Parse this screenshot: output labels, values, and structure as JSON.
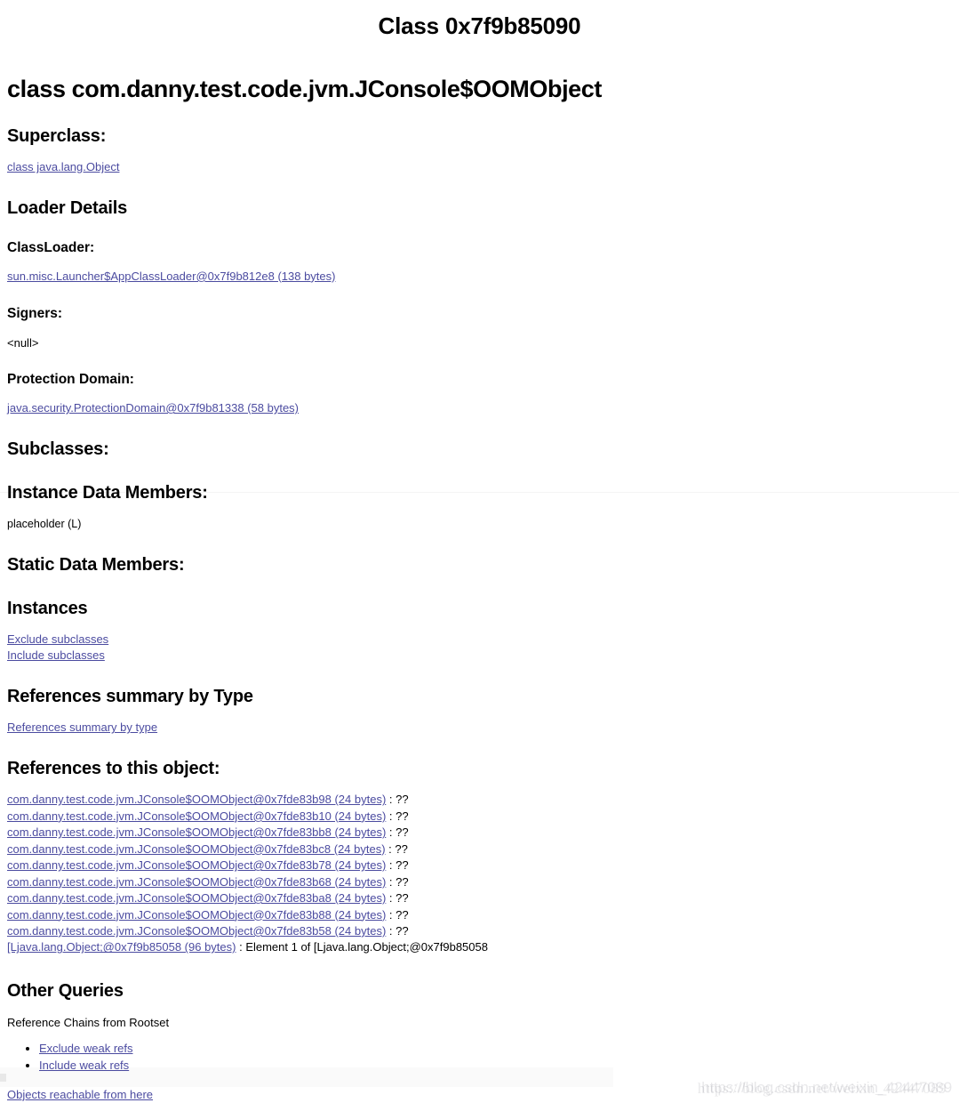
{
  "document": {
    "title": "Class 0x7f9b85090",
    "class_header": "class com.danny.test.code.jvm.JConsole$OOMObject"
  },
  "superclass": {
    "heading": "Superclass:",
    "link": "class java.lang.Object"
  },
  "loader_details": {
    "heading": "Loader Details",
    "classloader_label": "ClassLoader:",
    "classloader_link": "sun.misc.Launcher$AppClassLoader@0x7f9b812e8 (138 bytes)",
    "signers_label": "Signers:",
    "signers_value": "<null>",
    "protection_domain_label": "Protection Domain:",
    "protection_domain_link": "java.security.ProtectionDomain@0x7f9b81338 (58 bytes)"
  },
  "subclasses": {
    "heading": "Subclasses:"
  },
  "instance_data_members": {
    "heading": "Instance Data Members:",
    "members": [
      "placeholder (L)"
    ]
  },
  "static_data_members": {
    "heading": "Static Data Members:"
  },
  "instances": {
    "heading": "Instances",
    "links": [
      "Exclude subclasses",
      "Include subclasses"
    ]
  },
  "references_summary": {
    "heading": "References summary by Type",
    "link": "References summary by type"
  },
  "references_to_object": {
    "heading": "References to this object:",
    "rows": [
      {
        "link": "com.danny.test.code.jvm.JConsole$OOMObject@0x7fde83b98 (24 bytes)",
        "separator": " : ",
        "detail": "??"
      },
      {
        "link": "com.danny.test.code.jvm.JConsole$OOMObject@0x7fde83b10 (24 bytes)",
        "separator": " : ",
        "detail": "??"
      },
      {
        "link": "com.danny.test.code.jvm.JConsole$OOMObject@0x7fde83bb8 (24 bytes)",
        "separator": " : ",
        "detail": "??"
      },
      {
        "link": "com.danny.test.code.jvm.JConsole$OOMObject@0x7fde83bc8 (24 bytes)",
        "separator": " : ",
        "detail": "??"
      },
      {
        "link": "com.danny.test.code.jvm.JConsole$OOMObject@0x7fde83b78 (24 bytes)",
        "separator": " : ",
        "detail": "??"
      },
      {
        "link": "com.danny.test.code.jvm.JConsole$OOMObject@0x7fde83b68 (24 bytes)",
        "separator": " : ",
        "detail": "??"
      },
      {
        "link": "com.danny.test.code.jvm.JConsole$OOMObject@0x7fde83ba8 (24 bytes)",
        "separator": " : ",
        "detail": "??"
      },
      {
        "link": "com.danny.test.code.jvm.JConsole$OOMObject@0x7fde83b88 (24 bytes)",
        "separator": " : ",
        "detail": "??"
      },
      {
        "link": "com.danny.test.code.jvm.JConsole$OOMObject@0x7fde83b58 (24 bytes)",
        "separator": " : ",
        "detail": "??"
      },
      {
        "link": "[Ljava.lang.Object;@0x7f9b85058 (96 bytes)",
        "separator": " : ",
        "detail": "Element 1 of [Ljava.lang.Object;@0x7f9b85058"
      }
    ]
  },
  "other_queries": {
    "heading": "Other Queries",
    "reference_chains_label": "Reference Chains from Rootset",
    "bullets": [
      "Exclude weak refs",
      "Include weak refs"
    ],
    "reachable_link": "Objects reachable from here"
  },
  "watermark": {
    "text_primary": "https://blog.csdn.net/weixin_42447089",
    "text_secondary": "https://blog.csdn.net/weixin_42447089"
  },
  "colors": {
    "link": "#4b4ba0",
    "text": "#000000",
    "background": "#ffffff"
  }
}
